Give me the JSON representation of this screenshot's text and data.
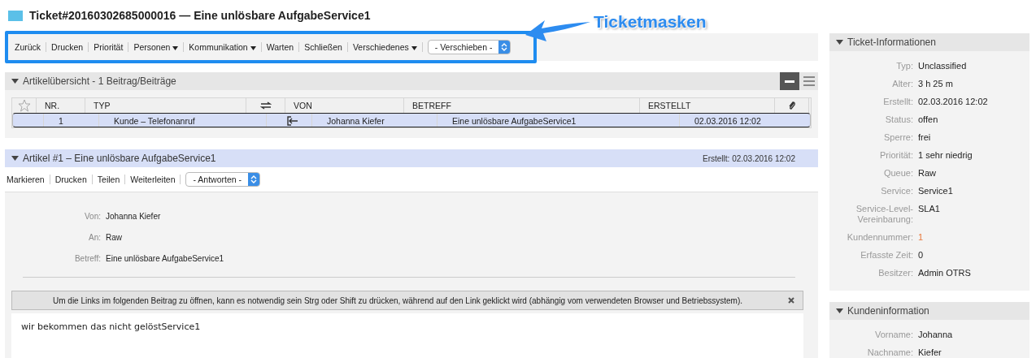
{
  "title": "Ticket#20160302685000016 — Eine unlösbare AufgabeService1",
  "annotation": "Ticketmasken",
  "toolbar": {
    "items": [
      {
        "label": "Zurück",
        "dropdown": false
      },
      {
        "label": "Drucken",
        "dropdown": false
      },
      {
        "label": "Priorität",
        "dropdown": false
      },
      {
        "label": "Personen",
        "dropdown": true
      },
      {
        "label": "Kommunikation",
        "dropdown": true
      },
      {
        "label": "Warten",
        "dropdown": false
      },
      {
        "label": "Schließen",
        "dropdown": false
      },
      {
        "label": "Verschiedenes",
        "dropdown": true
      }
    ],
    "select": "- Verschieben -"
  },
  "overview": {
    "title": "Artikelübersicht - 1 Beitrag/Beiträge",
    "expanded": true,
    "columns": [
      "NR.",
      "TYP",
      "VON",
      "BETREFF",
      "ERSTELLT"
    ],
    "rows": [
      {
        "nr": "1",
        "typ": "Kunde – Telefonanruf",
        "von": "Johanna Kiefer",
        "betreff": "Eine unlösbare AufgabeService1",
        "erstellt": "02.03.2016 12:02",
        "selected": true
      }
    ]
  },
  "article": {
    "title": "Artikel #1 – Eine unlösbare AufgabeService1",
    "created": "Erstellt: 02.03.2016 12:02",
    "expanded": true,
    "actions": [
      "Markieren",
      "Drucken",
      "Teilen",
      "Weiterleiten"
    ],
    "select": "- Antworten -",
    "fields": [
      {
        "label": "Von:",
        "value": "Johanna Kiefer"
      },
      {
        "label": "An:",
        "value": "Raw"
      },
      {
        "label": "Betreff:",
        "value": "Eine unlösbare AufgabeService1"
      }
    ],
    "notice": "Um die Links im folgenden Beitrag zu öffnen, kann es notwendig sein Strg oder Shift zu drücken, während auf den Link geklickt wird (abhängig vom verwendeten Browser und Betriebssystem).",
    "body": "wir bekommen das nicht gelöstService1"
  },
  "sidebar": [
    {
      "title": "Ticket-Informationen",
      "expanded": true,
      "fields": [
        {
          "label": "Typ:",
          "value": "Unclassified",
          "link": false
        },
        {
          "label": "Alter:",
          "value": "3 h 25 m",
          "link": false
        },
        {
          "label": "Erstellt:",
          "value": "02.03.2016 12:02",
          "link": false
        },
        {
          "label": "Status:",
          "value": "offen",
          "link": false
        },
        {
          "label": "Sperre:",
          "value": "frei",
          "link": false
        },
        {
          "label": "Priorität:",
          "value": "1 sehr niedrig",
          "link": false
        },
        {
          "label": "Queue:",
          "value": "Raw",
          "link": false
        },
        {
          "label": "Service:",
          "value": "Service1",
          "link": false
        },
        {
          "label": "Service-Level-Vereinbarung:",
          "value": "SLA1",
          "link": false
        },
        {
          "label": "Kundennummer:",
          "value": "1",
          "link": true
        },
        {
          "label": "Erfasste Zeit:",
          "value": "0",
          "link": false
        },
        {
          "label": "Besitzer:",
          "value": "Admin OTRS",
          "link": false
        }
      ]
    },
    {
      "title": "Kundeninformation",
      "expanded": true,
      "fields": [
        {
          "label": "Vorname:",
          "value": "Johanna",
          "link": false
        },
        {
          "label": "Nachname:",
          "value": "Kiefer",
          "link": false
        }
      ]
    }
  ]
}
